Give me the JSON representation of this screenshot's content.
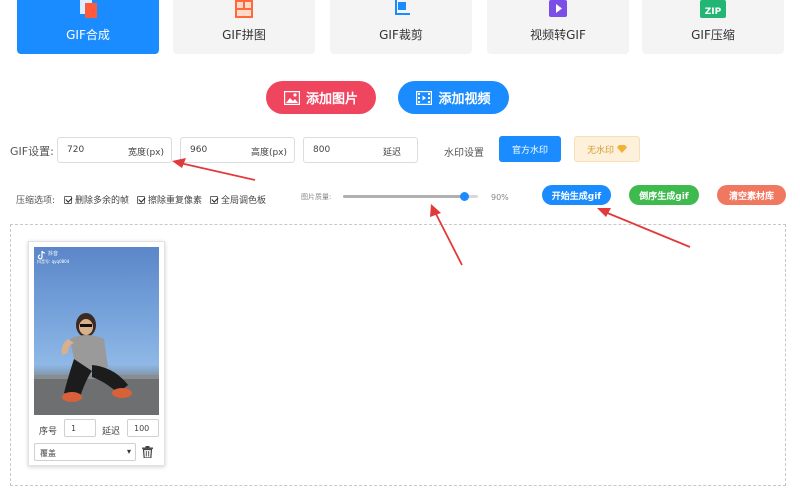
{
  "tabs": [
    {
      "label": "GIF合成",
      "icon": "layers-icon",
      "active": true
    },
    {
      "label": "GIF拼图",
      "icon": "grid-icon",
      "active": false
    },
    {
      "label": "GIF裁剪",
      "icon": "crop-icon",
      "active": false
    },
    {
      "label": "视频转GIF",
      "icon": "video-icon",
      "active": false
    },
    {
      "label": "GIF压缩",
      "icon": "zip-icon",
      "active": false
    }
  ],
  "zip_icon_text": "ZIP",
  "add_buttons": {
    "add_image": "添加图片",
    "add_video": "添加视频"
  },
  "gif_settings": {
    "label": "GIF设置:",
    "width_value": "720",
    "width_unit": "宽度(px)",
    "height_value": "960",
    "height_unit": "高度(px)",
    "delay_value": "800",
    "delay_unit": "延迟"
  },
  "watermark": {
    "label": "水印设置",
    "official": "官方水印",
    "none": "无水印"
  },
  "compress": {
    "label": "压缩选项:",
    "options": [
      {
        "label": "删除多余的帧",
        "checked": true
      },
      {
        "label": "擦除重复像素",
        "checked": true
      },
      {
        "label": "全局调色板",
        "checked": true
      }
    ],
    "quality_label": "图片质量:",
    "quality_value": "90%",
    "quality_fraction": 0.9
  },
  "actions": {
    "start": "开始生成gif",
    "reverse": "倒序生成gif",
    "clear": "清空素材库"
  },
  "frame_card": {
    "overlay_app": "抖音",
    "overlay_id": "抖音号: qyq0804",
    "seq_label": "序号",
    "seq_value": "1",
    "delay_label": "延迟",
    "delay_value": "100",
    "mode_value": "覆盖"
  },
  "colors": {
    "primary": "#1a8cff",
    "pink": "#f0455f",
    "green": "#3fba4f",
    "orange": "#f07861",
    "arrow": "#e23a3a"
  }
}
